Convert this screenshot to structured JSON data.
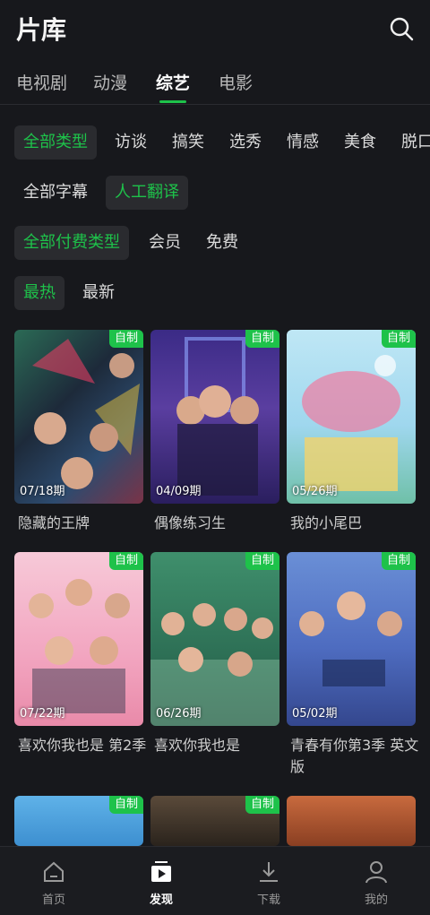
{
  "header": {
    "title": "片库",
    "search_icon": "search-icon"
  },
  "tabs": [
    {
      "label": "电视剧"
    },
    {
      "label": "动漫"
    },
    {
      "label": "综艺"
    },
    {
      "label": "电影"
    }
  ],
  "filters": {
    "type": [
      "全部类型",
      "访谈",
      "搞笑",
      "选秀",
      "情感",
      "美食",
      "脱口"
    ],
    "subtitle": [
      "全部字幕",
      "人工翻译"
    ],
    "pay": [
      "全部付费类型",
      "会员",
      "免费"
    ],
    "sort": [
      "最热",
      "最新"
    ]
  },
  "shows": [
    {
      "title": "隐藏的王牌",
      "episode": "07/18期",
      "badge": "自制"
    },
    {
      "title": "偶像练习生",
      "episode": "04/09期",
      "badge": "自制"
    },
    {
      "title": "我的小尾巴",
      "episode": "05/26期",
      "badge": "自制"
    },
    {
      "title": "喜欢你我也是 第2季",
      "episode": "07/22期",
      "badge": "自制"
    },
    {
      "title": "喜欢你我也是",
      "episode": "06/26期",
      "badge": "自制"
    },
    {
      "title": "青春有你第3季 英文版",
      "episode": "05/02期",
      "badge": "自制"
    },
    {
      "title": "",
      "episode": "",
      "badge": "自制"
    },
    {
      "title": "",
      "episode": "",
      "badge": "自制"
    }
  ],
  "bottom_nav": [
    {
      "label": "首页",
      "icon": "home-icon"
    },
    {
      "label": "发现",
      "icon": "discover-icon"
    },
    {
      "label": "下载",
      "icon": "download-icon"
    },
    {
      "label": "我的",
      "icon": "profile-icon"
    }
  ],
  "colors": {
    "accent": "#1ec24a",
    "background": "#17181c"
  }
}
